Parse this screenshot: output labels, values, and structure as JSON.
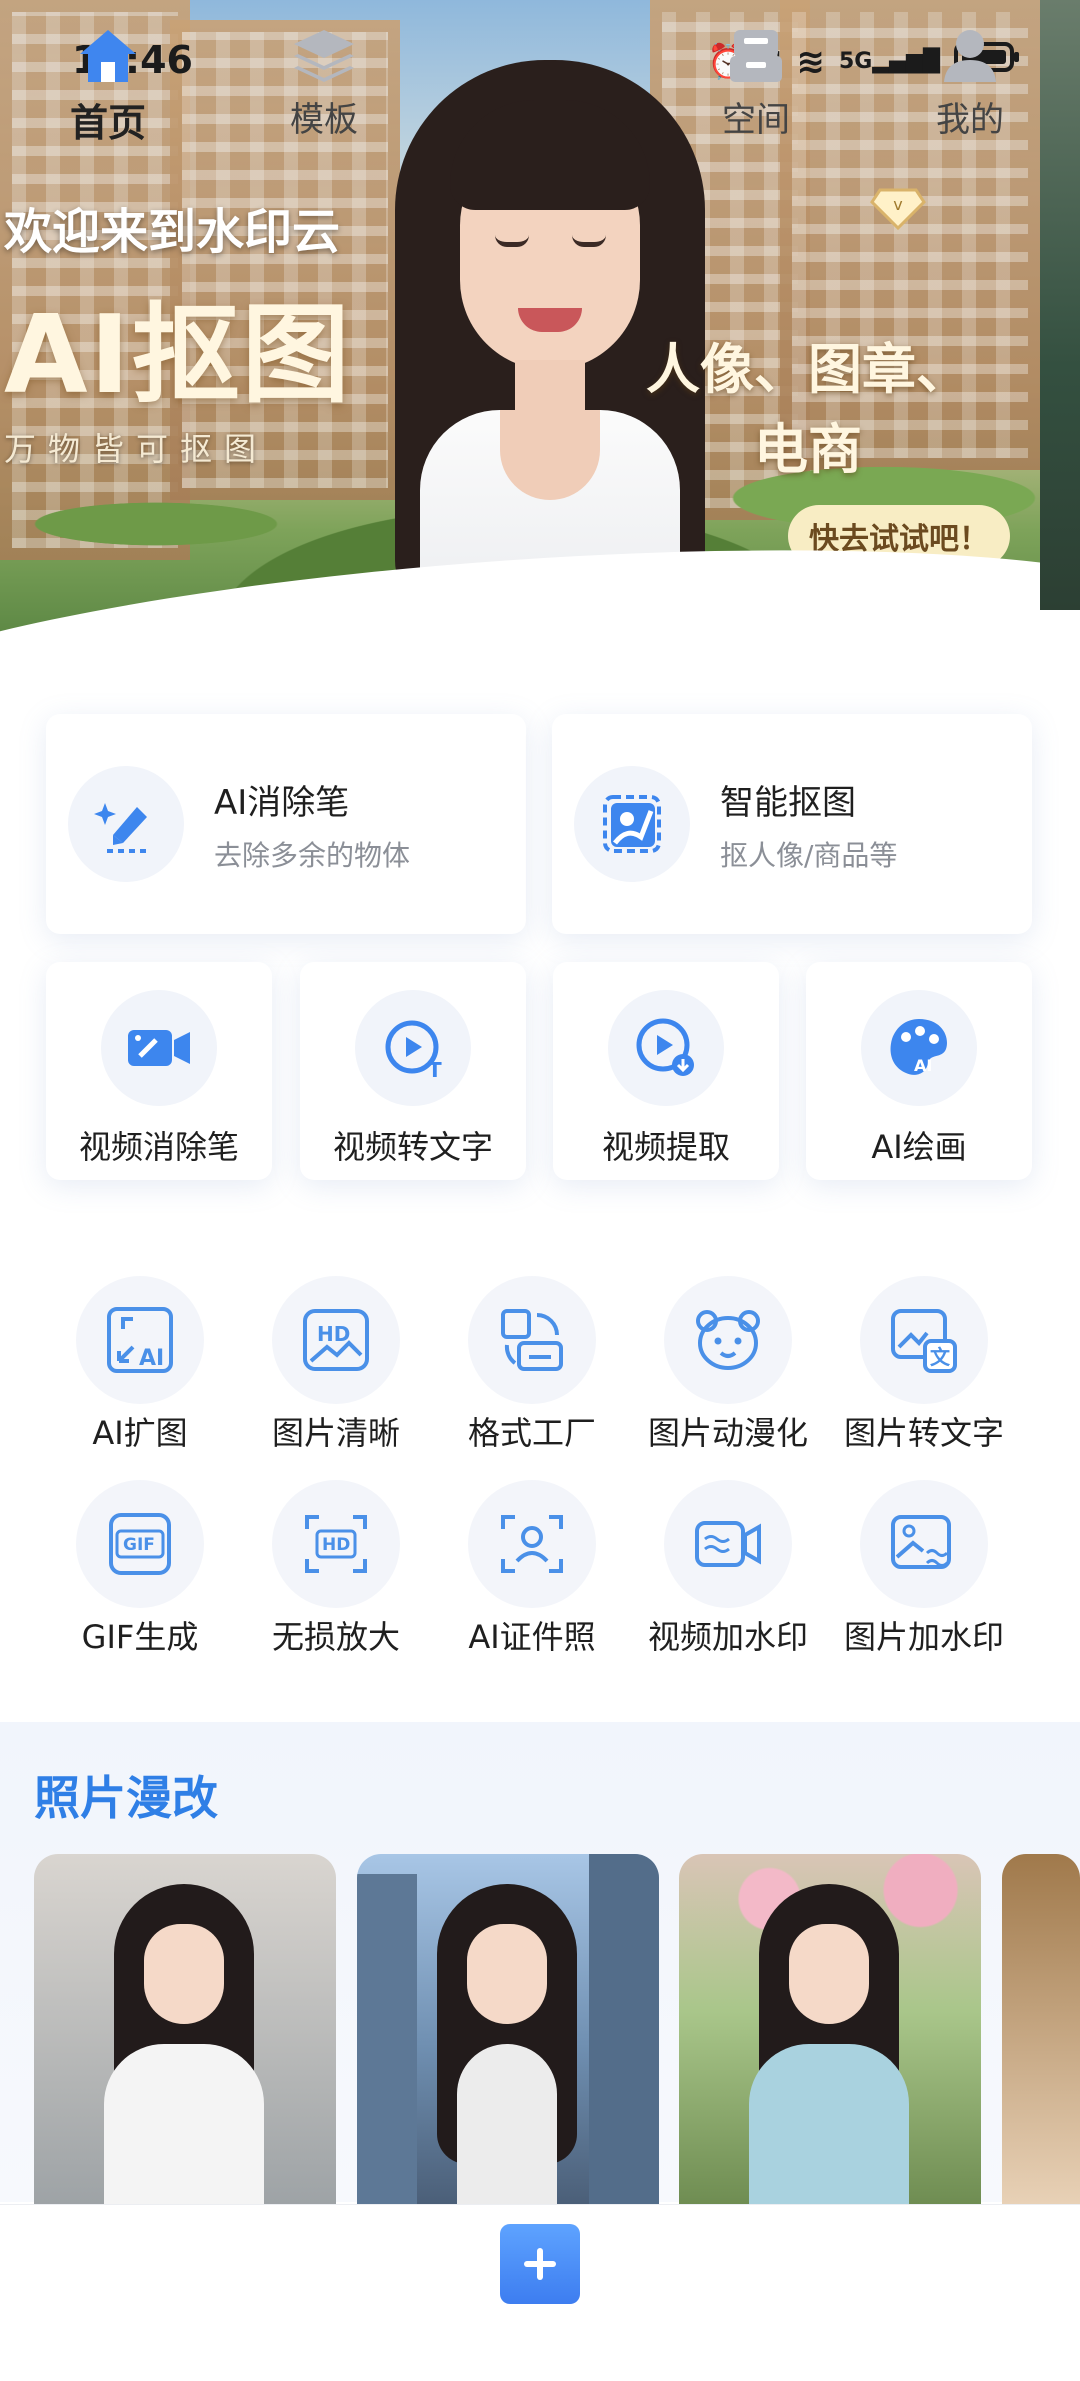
{
  "status_bar": {
    "time": "16:46",
    "network": "5G"
  },
  "banner": {
    "welcome": "欢迎来到水印云",
    "title": "AI抠图",
    "subtitle": "万物皆可抠图",
    "tag_line1": "人像、图章、",
    "tag_line2": "电商",
    "cta": "快去试试吧！"
  },
  "feature_cards": [
    {
      "title": "AI消除笔",
      "desc": "去除多余的物体",
      "icon": "eraser-pen-icon"
    },
    {
      "title": "智能抠图",
      "desc": "抠人像/商品等",
      "icon": "smart-cutout-icon"
    }
  ],
  "video_tools": [
    {
      "label": "视频消除笔",
      "icon": "video-eraser-icon"
    },
    {
      "label": "视频转文字",
      "icon": "video-to-text-icon"
    },
    {
      "label": "视频提取",
      "icon": "video-extract-icon"
    },
    {
      "label": "AI绘画",
      "icon": "ai-painting-icon"
    }
  ],
  "tools": [
    {
      "label": "AI扩图",
      "icon": "ai-expand-icon"
    },
    {
      "label": "图片清晰",
      "icon": "hd-image-icon"
    },
    {
      "label": "格式工厂",
      "icon": "format-factory-icon"
    },
    {
      "label": "图片动漫化",
      "icon": "anime-bear-icon"
    },
    {
      "label": "图片转文字",
      "icon": "image-to-text-icon"
    },
    {
      "label": "GIF生成",
      "icon": "gif-icon"
    },
    {
      "label": "无损放大",
      "icon": "hd-upscale-icon"
    },
    {
      "label": "AI证件照",
      "icon": "id-photo-icon"
    },
    {
      "label": "视频加水印",
      "icon": "video-watermark-icon"
    },
    {
      "label": "图片加水印",
      "icon": "image-watermark-icon"
    }
  ],
  "photo_section": {
    "title": "照片漫改"
  },
  "bottom_nav": [
    {
      "label": "首页",
      "icon": "home-icon",
      "active": true
    },
    {
      "label": "模板",
      "icon": "layers-icon",
      "active": false
    },
    {
      "label": "",
      "icon": "plus-icon",
      "active": false
    },
    {
      "label": "空间",
      "icon": "storage-icon",
      "active": false
    },
    {
      "label": "我的",
      "icon": "profile-icon",
      "active": false
    }
  ],
  "colors": {
    "accent": "#3d7df0",
    "section_title": "#2f7fe6",
    "icon_blue": "#4a90e8"
  }
}
